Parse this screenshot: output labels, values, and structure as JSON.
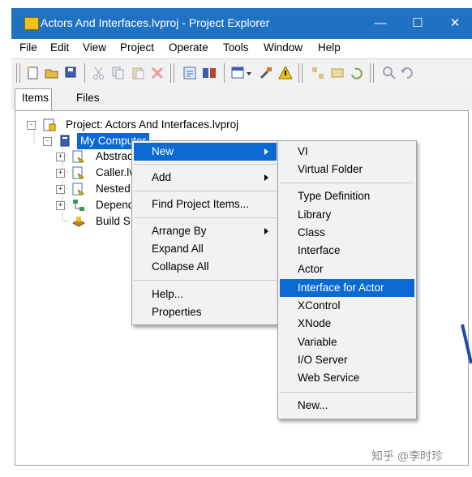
{
  "window": {
    "title": "Actors And Interfaces.lvproj - Project Explorer",
    "controls": {
      "minimize": "—",
      "maximize": "☐",
      "close": "✕"
    }
  },
  "menubar": [
    "File",
    "Edit",
    "View",
    "Project",
    "Operate",
    "Tools",
    "Window",
    "Help"
  ],
  "tabs": [
    "Items",
    "Files"
  ],
  "tree": {
    "root": "Project: Actors And Interfaces.lvproj",
    "computer": "My Computer",
    "children": [
      "Abstrac",
      "Caller.lv",
      "Nested",
      "Depend",
      "Build S"
    ]
  },
  "context_menu": {
    "items": [
      "New",
      "Add",
      "Find Project Items...",
      "Arrange By",
      "Expand All",
      "Collapse All",
      "Help...",
      "Properties"
    ]
  },
  "submenu_new": {
    "items": [
      "VI",
      "Virtual Folder",
      "Type Definition",
      "Library",
      "Class",
      "Interface",
      "Actor",
      "Interface for Actor",
      "XControl",
      "XNode",
      "Variable",
      "I/O Server",
      "Web Service",
      "New..."
    ],
    "highlighted": "Interface for Actor"
  },
  "watermark": "知乎 @李时珍",
  "colors": {
    "titlebar": "#1f72c2",
    "highlight": "#0a6ad1"
  }
}
